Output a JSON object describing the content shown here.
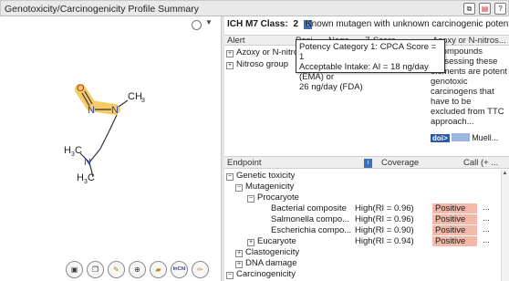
{
  "window": {
    "title": "Genotoxicity/Carcinogenicity Profile Summary",
    "icons": [
      "copy-icon",
      "pdf-icon",
      "help-icon"
    ]
  },
  "structure": {
    "atoms": {
      "o": "O",
      "n1": "N",
      "n2": "N",
      "n3": "N",
      "me_top": "CH",
      "h3c_1": "H",
      "c3_1": "C",
      "sub3_1": "3",
      "h3c_2": "H",
      "c3_2": "C",
      "sub3_2": "3",
      "sub3_top": "3"
    },
    "highlight_color": "#f5c24b"
  },
  "toolbar": {
    "buttons": [
      "clipboard-icon",
      "copy-doc-icon",
      "edit-structure-icon",
      "zoom-icon",
      "folder-icon",
      "inchi-icon",
      "pencil-icon"
    ],
    "inchi_label": "InChI"
  },
  "ich": {
    "label": "ICH M7 Class:",
    "value": "2",
    "description": "Known mutagen with unknown carcinogenic potential"
  },
  "alerts_grid": {
    "columns": [
      "Alert",
      "Posi...",
      "Nega...",
      "Z-Score",
      "Azoxy or N-nitros..."
    ],
    "rows": [
      "Azoxy or N-nitros",
      "Nitroso group"
    ],
    "description": "...compounds possessing these elements are potent genotoxic carcinogens that have to be excluded from TTC approach...",
    "doi_label": "doi>",
    "ref_author": "Muell..."
  },
  "tooltip": {
    "line1": "Potency Category 1: CPCA Score = 1",
    "line2": "Acceptable Intake: AI = 18 ng/day (EMA) or",
    "line3": "26 ng/day (FDA)"
  },
  "endpoints": {
    "columns": [
      "Endpoint",
      "Coverage",
      "Call (+ ..."
    ],
    "tree": [
      {
        "label": "Genetic toxicity",
        "toggle": "minus",
        "coverage": "",
        "call": ""
      },
      {
        "label": "Mutagenicity",
        "toggle": "minus",
        "coverage": "",
        "call": ""
      },
      {
        "label": "Procaryote",
        "toggle": "minus",
        "coverage": "",
        "call": ""
      },
      {
        "label": "Bacterial composite",
        "toggle": "",
        "coverage": "High(RI = 0.96)",
        "call": "Positive"
      },
      {
        "label": "Salmonella compo...",
        "toggle": "",
        "coverage": "High(RI = 0.96)",
        "call": "Positive"
      },
      {
        "label": "Escherichia compo...",
        "toggle": "",
        "coverage": "High(RI = 0.90)",
        "call": "Positive"
      },
      {
        "label": "Eucaryote",
        "toggle": "plus",
        "coverage": "High(RI = 0.94)",
        "call": "Positive"
      },
      {
        "label": "Clastogenicity",
        "toggle": "plus",
        "coverage": "",
        "call": ""
      },
      {
        "label": "DNA damage",
        "toggle": "plus",
        "coverage": "",
        "call": ""
      },
      {
        "label": "Carcinogenicity",
        "toggle": "minus",
        "coverage": "",
        "call": ""
      }
    ],
    "ellipsis": "...",
    "positive_color": "#f2b8a8"
  }
}
